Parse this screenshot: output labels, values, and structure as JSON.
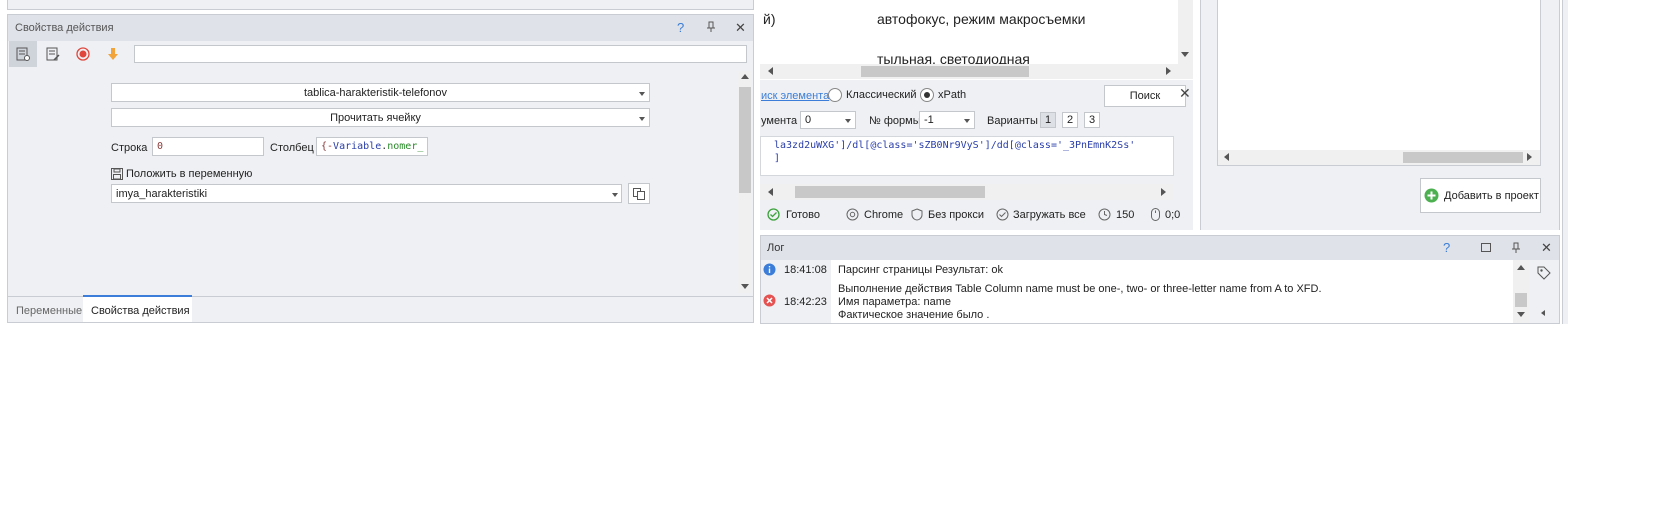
{
  "action_props": {
    "title": "Свойства действия",
    "help": "?",
    "pin": "⊣",
    "close": "✕",
    "table_select": "tablica-harakteristik-telefonov",
    "action_select": "Прочитать ячейку",
    "row_label": "Строка",
    "row_value": "0",
    "col_label": "Столбец",
    "col_value_brace": "{-",
    "col_value_var": "Variable",
    "col_value_dot": ".",
    "col_value_name": "nomer_",
    "save_label": "Положить в переменную",
    "variable_select": "imya_harakteristiki",
    "tab_variables": "Переменные",
    "tab_props": "Свойства действия"
  },
  "browser": {
    "text_line1": "й)",
    "text_line2": "автофокус, режим макросъемки",
    "text_line3": "тыльная, светодиодная"
  },
  "search": {
    "link": "иск элемента",
    "radio_classic": "Классический",
    "radio_xpath": "xPath",
    "search_button": "Поиск",
    "doc_label": "умента",
    "doc_value": "0",
    "form_label": "№ формы",
    "form_value": "-1",
    "variants_label": "Варианты",
    "v1": "1",
    "v2": "2",
    "v3": "3",
    "xpath_line1": "la3zd2uWXG']/dl[@class='sZB0Nr9VyS']/dd[@class='_3PnEmnK2Ss'",
    "xpath_line2": "]"
  },
  "status": {
    "ready": "Готово",
    "browser": "Chrome",
    "proxy": "Без прокси",
    "load": "Загружать все",
    "timeout": "150",
    "coords": "0;0"
  },
  "project": {
    "add_button": "Добавить в проект"
  },
  "log": {
    "title": "Лог",
    "entries": [
      {
        "time": "18:41:08",
        "text": "Парсинг страницы  Результат: ok"
      },
      {
        "time": "18:42:23",
        "line1": "Выполнение действия Table Column name must be one-, two- or three-letter name from A to XFD.",
        "line2": "Имя параметра: name",
        "line3": "Фактическое значение было ."
      }
    ]
  },
  "colors": {
    "accent_blue": "#3b7dd8",
    "record_red": "#e0463c",
    "arrow_orange": "#f2a33a",
    "error_red": "#e45252",
    "green": "#3ca23c",
    "header_bg": "#dfe2e8"
  }
}
